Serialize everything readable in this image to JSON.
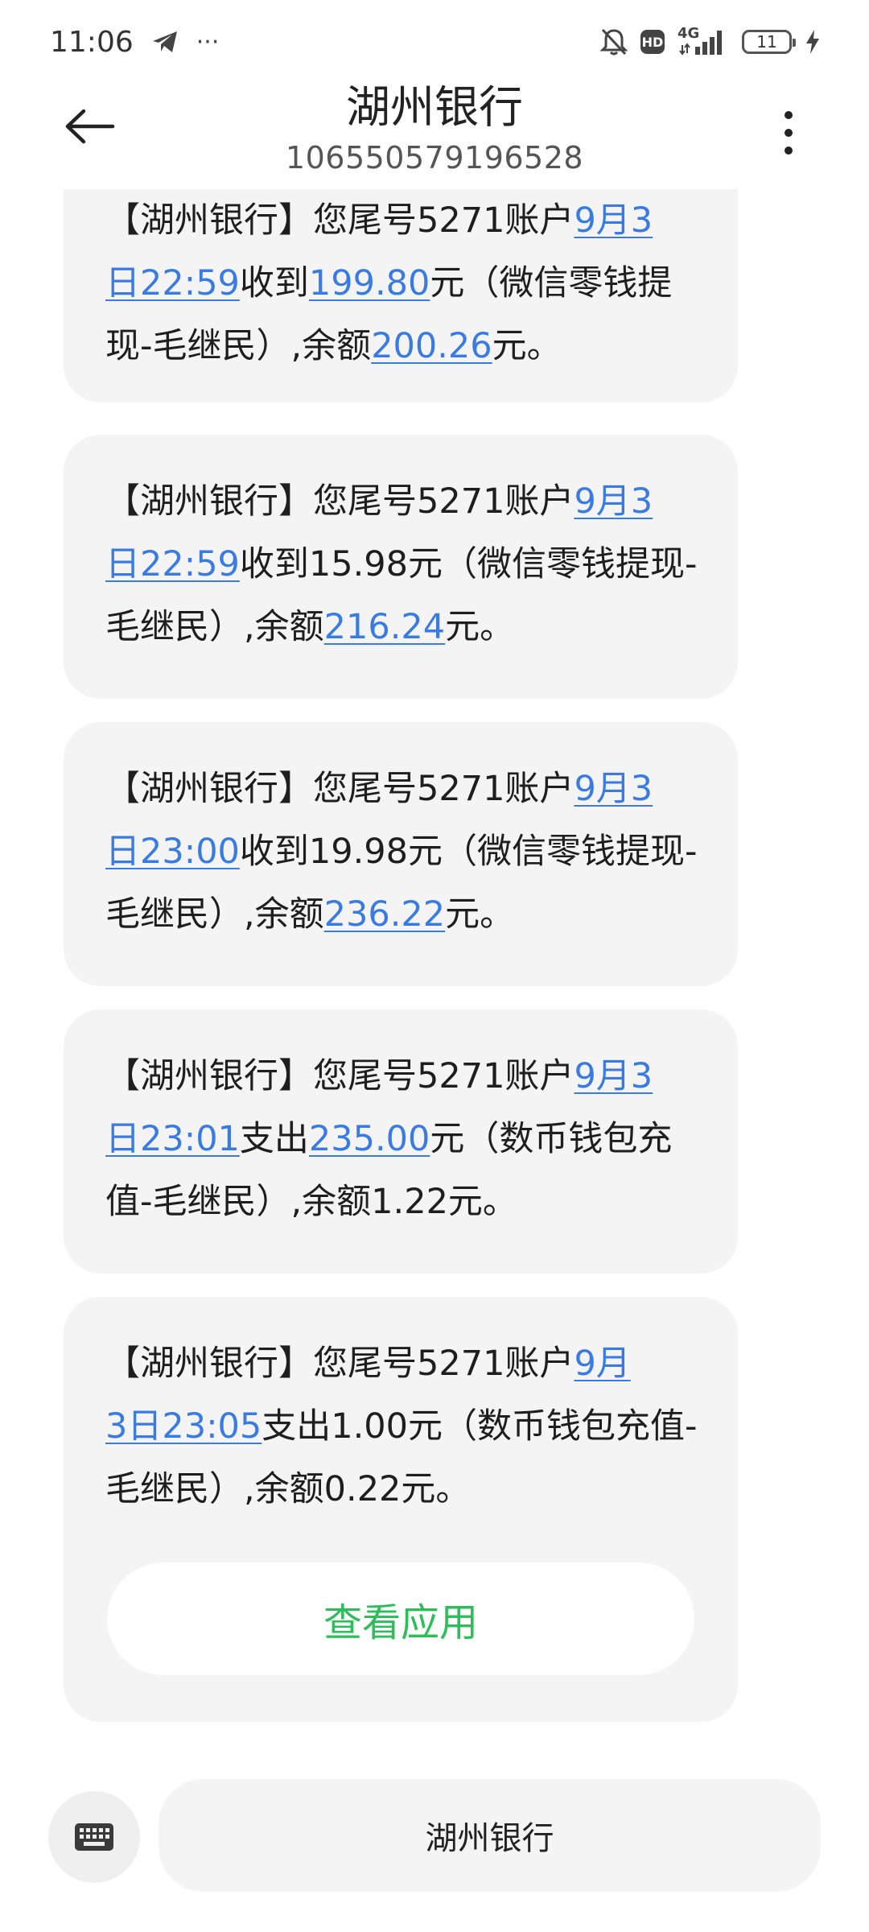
{
  "status_bar": {
    "time": "11:06",
    "dots": "···",
    "net_top": "4G",
    "battery": "11",
    "icons": [
      "telegram-icon",
      "bell-muted-icon",
      "hd-icon",
      "signal-icon",
      "battery-icon",
      "charging-icon"
    ]
  },
  "header": {
    "title": "湖州银行",
    "number": "106550579196528"
  },
  "messages": [
    {
      "p1": "【湖州银行】您尾号5271账户",
      "date_a": "9月3",
      "date_b": "日22:59",
      "p2": "收到",
      "amount": "199.80",
      "p3": "元（微信零钱提现-毛继民）,余额",
      "balance": "200.26",
      "p4": "元。"
    },
    {
      "p1": "【湖州银行】您尾号5271账户",
      "date_a": "9月3",
      "date_b": "日22:59",
      "p2": "收到15.98元（微信零钱提现-毛继民）,余额",
      "balance": "216.24",
      "p4": "元。"
    },
    {
      "p1": "【湖州银行】您尾号5271账户",
      "date_a": "9月3",
      "date_b": "日23:00",
      "p2": "收到19.98元（微信零钱提现-毛继民）,余额",
      "balance": "236.22",
      "p4": "元。"
    },
    {
      "p1": "【湖州银行】您尾号5271账户",
      "date_a": "9月3",
      "date_b": "日23:01",
      "p2": "支出",
      "amount": "235.00",
      "p3": "元（数币钱包充值-毛继民）,余额1.22元。"
    },
    {
      "p1": "【湖州银行】您尾号5271账户",
      "date_a": "9月",
      "date_b": "3日23:05",
      "p2": "支出1.00元（数币钱包充值-毛继民）,余额0.22元。",
      "button": "查看应用"
    }
  ],
  "bottom": {
    "input_label": "湖州银行"
  },
  "colors": {
    "link": "#3a7be3",
    "bubble": "#f4f4f4",
    "button_text": "#2dbd5a"
  }
}
